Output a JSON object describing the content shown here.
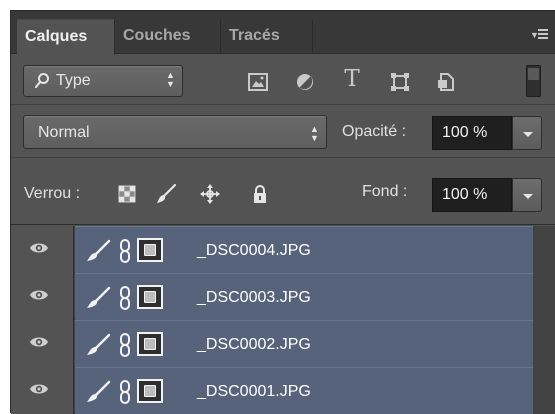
{
  "tabs": [
    {
      "label": "Calques",
      "active": true
    },
    {
      "label": "Couches",
      "active": false
    },
    {
      "label": "Tracés",
      "active": false
    }
  ],
  "filter": {
    "kind_label": "Type",
    "icons": [
      "pixel-layer-filter-icon",
      "adjustment-layer-filter-icon",
      "type-layer-filter-icon",
      "shape-layer-filter-icon",
      "smart-object-filter-icon"
    ]
  },
  "blend": {
    "mode": "Normal",
    "opacity_label": "Opacité :",
    "opacity_value": "100 %"
  },
  "lock": {
    "label": "Verrou :",
    "icons": [
      "lock-transparent-pixels-icon",
      "lock-image-pixels-icon",
      "lock-position-icon",
      "lock-all-icon"
    ],
    "fill_label": "Fond :",
    "fill_value": "100 %"
  },
  "layers": [
    {
      "name": "_DSC0004.JPG",
      "visible": true,
      "selected": true
    },
    {
      "name": "_DSC0003.JPG",
      "visible": true,
      "selected": true
    },
    {
      "name": "_DSC0002.JPG",
      "visible": true,
      "selected": true
    },
    {
      "name": "_DSC0001.JPG",
      "visible": true,
      "selected": true
    }
  ],
  "colors": {
    "panel_bg": "#535353",
    "tabbar_bg": "#383838",
    "selected_layer": "#56637b",
    "field_bg": "#1f1f1f"
  }
}
